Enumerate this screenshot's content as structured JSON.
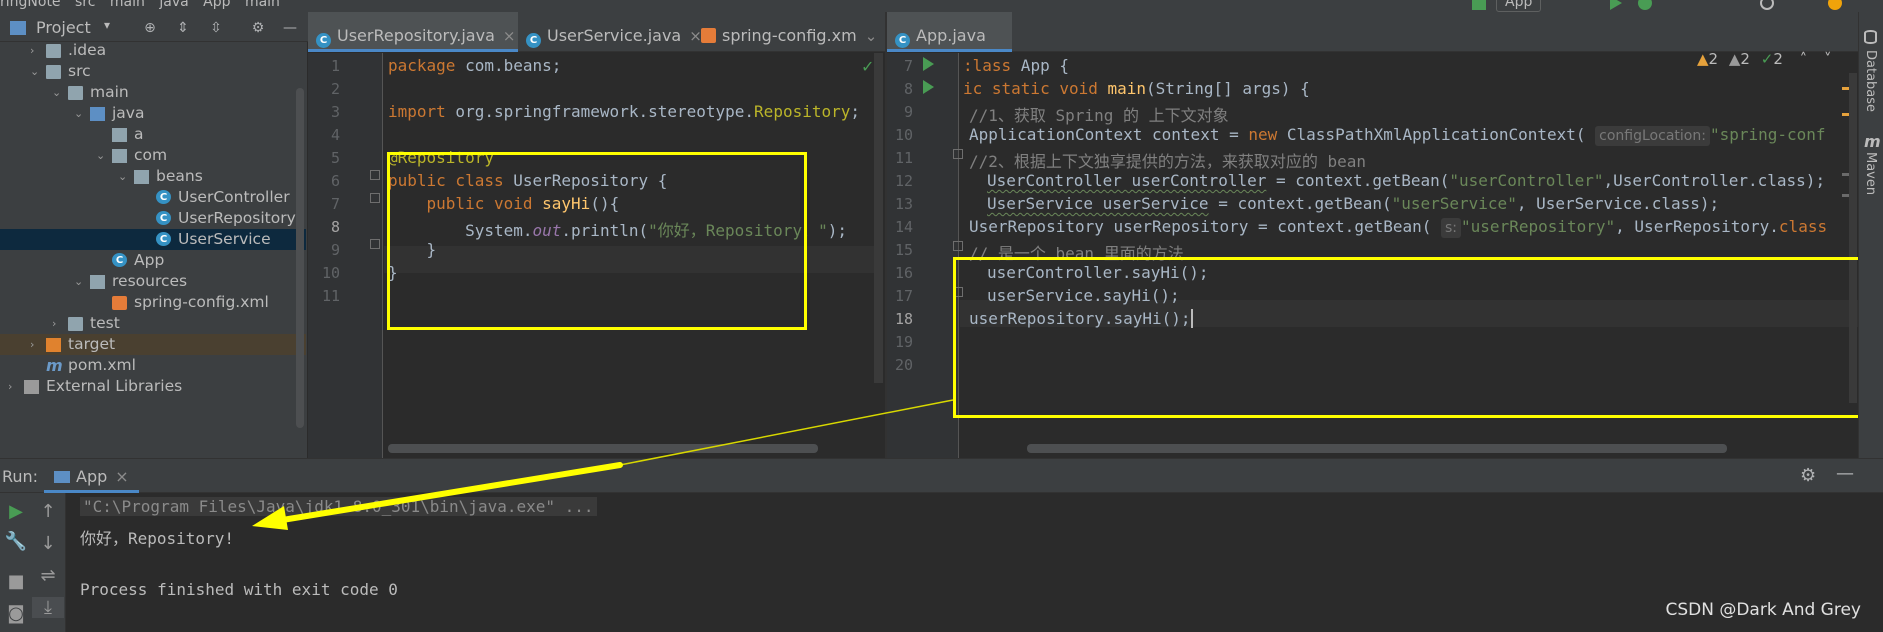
{
  "breadcrumbs": [
    "ringNote",
    "src",
    "main",
    "java",
    "App",
    "main"
  ],
  "toolbar": {
    "run_config": "App"
  },
  "project_panel": {
    "title": "Project",
    "tree": [
      {
        "label": ".idea",
        "depth": 1,
        "icon": "folder-icon",
        "arrow": "right"
      },
      {
        "label": "src",
        "depth": 1,
        "icon": "folder-icon",
        "arrow": "down"
      },
      {
        "label": "main",
        "depth": 2,
        "icon": "folder-icon",
        "arrow": "down"
      },
      {
        "label": "java",
        "depth": 3,
        "icon": "source-folder-icon",
        "arrow": "down"
      },
      {
        "label": "a",
        "depth": 4,
        "icon": "package-icon",
        "arrow": ""
      },
      {
        "label": "com",
        "depth": 4,
        "icon": "package-icon",
        "arrow": "down"
      },
      {
        "label": "beans",
        "depth": 5,
        "icon": "package-icon",
        "arrow": "down"
      },
      {
        "label": "UserController",
        "depth": 6,
        "icon": "class-icon",
        "arrow": ""
      },
      {
        "label": "UserRepository",
        "depth": 6,
        "icon": "class-icon",
        "arrow": ""
      },
      {
        "label": "UserService",
        "depth": 6,
        "icon": "class-icon",
        "arrow": "",
        "selected": true
      },
      {
        "label": "App",
        "depth": 4,
        "icon": "class-icon",
        "arrow": ""
      },
      {
        "label": "resources",
        "depth": 3,
        "icon": "resources-folder-icon",
        "arrow": "down"
      },
      {
        "label": "spring-config.xml",
        "depth": 4,
        "icon": "xml-icon",
        "arrow": ""
      },
      {
        "label": "test",
        "depth": 2,
        "icon": "folder-icon",
        "arrow": "right"
      },
      {
        "label": "target",
        "depth": 1,
        "icon": "excluded-folder-icon",
        "arrow": "right",
        "excluded": true
      },
      {
        "label": "pom.xml",
        "depth": 1,
        "icon": "maven-icon",
        "arrow": ""
      },
      {
        "label": "External Libraries",
        "depth": 0,
        "icon": "library-icon",
        "arrow": "right"
      }
    ]
  },
  "editor_left": {
    "tabs": [
      {
        "label": "UserRepository.java",
        "active": true
      },
      {
        "label": "UserService.java",
        "active": false
      },
      {
        "label": "spring-config.xm",
        "active": false
      }
    ],
    "line_numbers": [
      "1",
      "2",
      "3",
      "4",
      "5",
      "6",
      "7",
      "8",
      "9",
      "10",
      "11"
    ],
    "current_line": "8"
  },
  "editor_right": {
    "tabs": [
      {
        "label": "App.java",
        "active": true
      }
    ],
    "line_numbers": [
      "7",
      "8",
      "9",
      "10",
      "11",
      "12",
      "13",
      "14",
      "15",
      "16",
      "17",
      "18",
      "19",
      "20"
    ],
    "current_line": "18",
    "inspections": {
      "warn1": "2",
      "warn2": "2",
      "ok": "2"
    },
    "hints": {
      "config_location": "configLocation:",
      "s": "s:"
    }
  },
  "run_panel": {
    "label": "Run:",
    "tab": "App",
    "command": "\"C:\\Program Files\\Java\\jdk1.8.0_301\\bin\\java.exe\" ...",
    "output": "你好，Repository!",
    "exit": "Process finished with exit code 0"
  },
  "right_sidebar": {
    "database": "Database",
    "maven": "Maven"
  },
  "watermark": "CSDN @Dark And Grey",
  "colors": {
    "highlight": "#ffff00",
    "accent": "#4a88c7",
    "selection": "#0d293e"
  }
}
